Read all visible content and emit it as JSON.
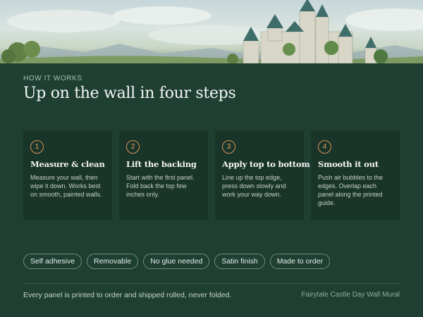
{
  "section": {
    "eyebrow": "HOW IT WORKS",
    "title": "Up on the wall in four steps"
  },
  "steps": [
    {
      "number": "1",
      "title": "Measure & clean",
      "text": "Measure your wall, then wipe it down. Works best on smooth, painted walls."
    },
    {
      "number": "2",
      "title": "Lift the backing",
      "text": "Start with the first panel. Fold back the top few inches only."
    },
    {
      "number": "3",
      "title": "Apply top to bottom",
      "text": "Line up the top edge, press down slowly and work your way down."
    },
    {
      "number": "4",
      "title": "Smooth it out",
      "text": "Push air bubbles to the edges. Overlap each panel along the printed guide."
    }
  ],
  "features": [
    "Self adhesive",
    "Removable",
    "No glue needed",
    "Satin finish",
    "Made to order"
  ],
  "footer": {
    "note": "Every panel is printed to order and shipped rolled, never folded.",
    "product": "Fairytale Castle Day Wall Mural"
  },
  "colors": {
    "background": "#1f3f33",
    "card": "#193429",
    "accent": "#d9925a"
  }
}
